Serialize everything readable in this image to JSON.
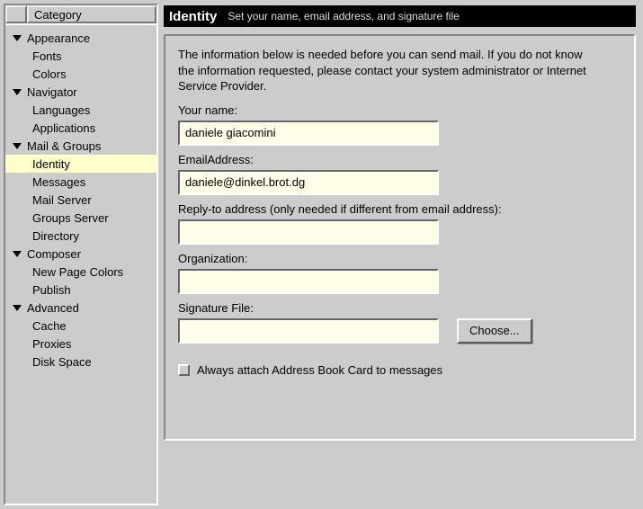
{
  "sidebar": {
    "header": "Category",
    "groups": [
      {
        "label": "Appearance",
        "children": [
          "Fonts",
          "Colors"
        ]
      },
      {
        "label": "Navigator",
        "children": [
          "Languages",
          "Applications"
        ]
      },
      {
        "label": "Mail & Groups",
        "children": [
          "Identity",
          "Messages",
          "Mail Server",
          "Groups Server",
          "Directory"
        ]
      },
      {
        "label": "Composer",
        "children": [
          "New Page Colors",
          "Publish"
        ]
      },
      {
        "label": "Advanced",
        "children": [
          "Cache",
          "Proxies",
          "Disk Space"
        ]
      }
    ],
    "selected": "Identity"
  },
  "titlebar": {
    "main": "Identity",
    "sub": "Set your name, email address, and signature file"
  },
  "panel": {
    "intro": "The information below is needed before you can send mail. If you do not know the information requested, please contact your system administrator or Internet Service Provider.",
    "name_label": "Your name:",
    "name_value": "daniele giacomini",
    "email_label": "EmailAddress:",
    "email_value": "daniele@dinkel.brot.dg",
    "reply_label": "Reply-to address (only needed if different from email address):",
    "reply_value": "",
    "org_label": "Organization:",
    "org_value": "",
    "sig_label": "Signature File:",
    "sig_value": "",
    "choose_btn": "Choose...",
    "checkbox_label": "Always attach Address Book Card to messages"
  }
}
